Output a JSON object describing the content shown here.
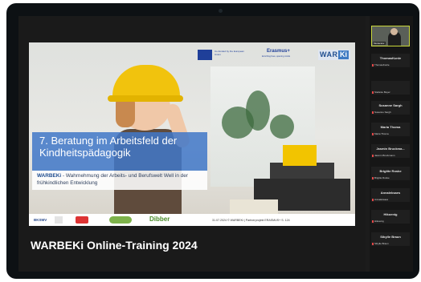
{
  "slide": {
    "title": "7. Beratung im Arbeitsfeld der Kindheitspädagogik",
    "subtitle_brand": "WARBEKi",
    "subtitle_rest": " - Wahrnehmung der Arbeits- und Berufswelt Well in der frühkindlichen Entwicklung",
    "logos": {
      "eu_text": "Co-funded by the European Union",
      "erasmus": "Erasmus+",
      "erasmus_sub": "Enriching lives, opening minds",
      "warbeki_a": "WARBE",
      "warbeki_b": "Ki"
    },
    "footer_logos": {
      "f1": "BKSMV",
      "f5": "Dibber"
    },
    "footnote": "31.07.2024 © WARBEKi | Partnerprojekt ERASMUS+ S. 124"
  },
  "caption": "WARBEKi Online-Training 2024",
  "participants": {
    "video_name": "Moderator",
    "tiles": [
      {
        "name": "ThomasKunle",
        "mic": "ThomasKunle"
      },
      {
        "name": "",
        "mic": "Stefanie Beyer"
      },
      {
        "name": "Susanne Sargh",
        "mic": "Susanne Sargh"
      },
      {
        "name": "Maria Thoma",
        "mic": "Maria Thoma"
      },
      {
        "name": "Jasmin Bruckma...",
        "mic": "Jasmin Bruckmann"
      },
      {
        "name": "Brigitte Roske",
        "mic": "Brigitte Roske"
      },
      {
        "name": "Annaleksaes",
        "mic": "Annaleksaes"
      },
      {
        "name": "Hikoenig",
        "mic": "Hikoenig"
      },
      {
        "name": "Sibylle Braun",
        "mic": "Sibylle Braun"
      }
    ]
  }
}
